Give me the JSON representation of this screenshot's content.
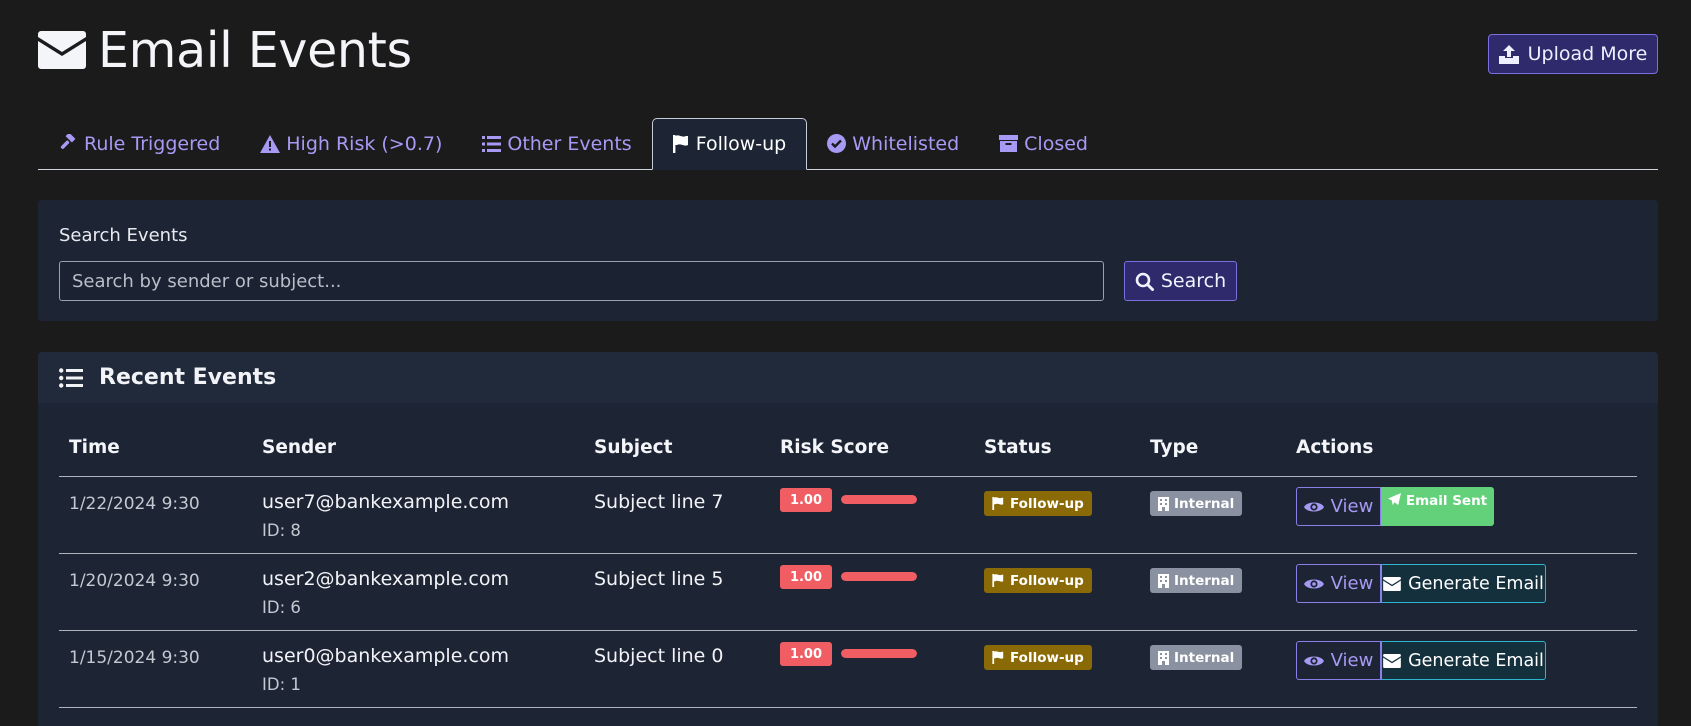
{
  "header": {
    "title": "Email Events",
    "title_icon": "envelope-icon",
    "upload_label": "Upload More",
    "upload_icon": "upload-icon"
  },
  "tabs": [
    {
      "label": "Rule Triggered",
      "icon": "gavel-icon",
      "active": false
    },
    {
      "label": "High Risk (>0.7)",
      "icon": "warning-icon",
      "active": false
    },
    {
      "label": "Other Events",
      "icon": "list-icon",
      "active": false
    },
    {
      "label": "Follow-up",
      "icon": "flag-icon",
      "active": true
    },
    {
      "label": "Whitelisted",
      "icon": "check-circle-icon",
      "active": false
    },
    {
      "label": "Closed",
      "icon": "archive-icon",
      "active": false
    }
  ],
  "search": {
    "label": "Search Events",
    "placeholder": "Search by sender or subject...",
    "value": "",
    "button_label": "Search"
  },
  "events": {
    "title": "Recent Events",
    "columns": [
      "Time",
      "Sender",
      "Subject",
      "Risk Score",
      "Status",
      "Type",
      "Actions"
    ],
    "rows": [
      {
        "time": "1/22/2024 9:30",
        "sender": "user7@bankexample.com",
        "id": "ID: 8",
        "subject": "Subject line 7",
        "risk": "1.00",
        "risk_fraction": 1.0,
        "status": "Follow-up",
        "type": "Internal",
        "view": "View",
        "action": "Email Sent",
        "action_kind": "sent"
      },
      {
        "time": "1/20/2024 9:30",
        "sender": "user2@bankexample.com",
        "id": "ID: 6",
        "subject": "Subject line 5",
        "risk": "1.00",
        "risk_fraction": 1.0,
        "status": "Follow-up",
        "type": "Internal",
        "view": "View",
        "action": "Generate Email",
        "action_kind": "generate"
      },
      {
        "time": "1/15/2024 9:30",
        "sender": "user0@bankexample.com",
        "id": "ID: 1",
        "subject": "Subject line 0",
        "risk": "1.00",
        "risk_fraction": 1.0,
        "status": "Follow-up",
        "type": "Internal",
        "view": "View",
        "action": "Generate Email",
        "action_kind": "generate"
      }
    ]
  },
  "colors": {
    "background": "#1b1b1c",
    "card": "#1d2434",
    "accent": "#a79af4",
    "risk": "#f05d63",
    "status_followup": "#8a6a06",
    "type_internal": "#8a91a0",
    "sent": "#62d17a",
    "generate_border": "#2fb6cf"
  }
}
